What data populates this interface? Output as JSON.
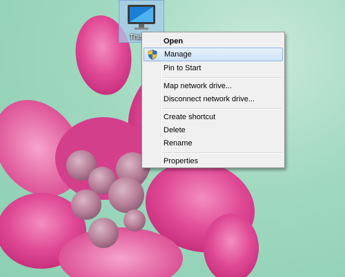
{
  "desktop": {
    "icon": {
      "name": "This",
      "icon": "computer-monitor-icon"
    }
  },
  "context_menu": {
    "items": [
      {
        "label": "Open",
        "bold": true
      },
      {
        "label": "Manage",
        "icon": "uac-shield-icon",
        "highlighted": true
      },
      {
        "label": "Pin to Start"
      },
      {
        "label": "Map network drive..."
      },
      {
        "label": "Disconnect network drive..."
      },
      {
        "label": "Create shortcut"
      },
      {
        "label": "Delete"
      },
      {
        "label": "Rename"
      },
      {
        "label": "Properties"
      }
    ]
  }
}
